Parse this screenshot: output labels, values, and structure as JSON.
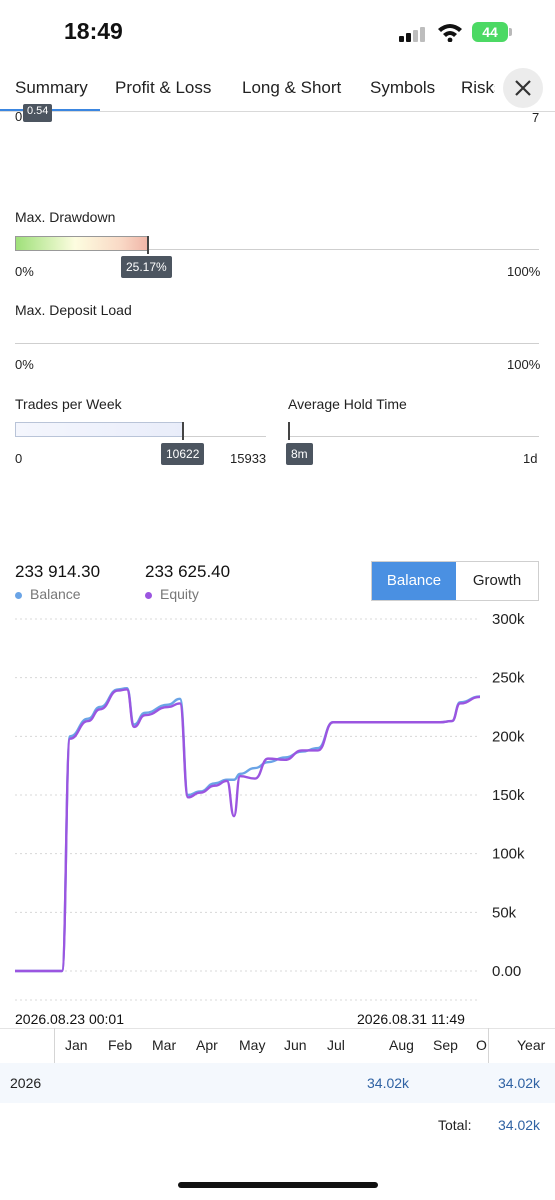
{
  "status_bar": {
    "time": "18:49",
    "battery": "44"
  },
  "tabs": [
    {
      "label": "Summary"
    },
    {
      "label": "Profit & Loss"
    },
    {
      "label": "Long & Short"
    },
    {
      "label": "Symbols"
    },
    {
      "label": "Risks"
    }
  ],
  "top_partial": {
    "left": "0.54",
    "right": "7"
  },
  "max_drawdown": {
    "label": "Max. Drawdown",
    "min": "0%",
    "max": "100%",
    "value": "25.17%",
    "fraction": 0.2517
  },
  "max_deposit_load": {
    "label": "Max. Deposit Load",
    "min": "0%",
    "max": "100%"
  },
  "trades_per_week": {
    "label": "Trades per Week",
    "min": "0",
    "max": "15933",
    "value": "10622",
    "fraction": 0.6667
  },
  "avg_hold_time": {
    "label": "Average Hold Time",
    "value": "8m",
    "max": "1d",
    "fraction": 0.0056
  },
  "summary_stats": {
    "balance_value": "233 914.30",
    "balance_label": "Balance",
    "equity_value": "233 625.40",
    "equity_label": "Equity"
  },
  "toggle": {
    "balance": "Balance",
    "growth": "Growth"
  },
  "colors": {
    "balance": "#6aa4e6",
    "equity": "#9b55e0",
    "accent": "#3b86e0",
    "button_active": "#4a90e2"
  },
  "chart_data": {
    "type": "line",
    "y_ticks": [
      "300k",
      "250k",
      "200k",
      "150k",
      "100k",
      "50k",
      "0.00"
    ],
    "ylim": [
      0,
      300000
    ],
    "x_start_label": "2026.08.23 00:01",
    "x_end_label": "2026.08.31 11:49",
    "series": [
      {
        "name": "Balance",
        "color": "#6aa4e6",
        "values": [
          0,
          0,
          200000,
          215000,
          225000,
          240000,
          241000,
          210000,
          220000,
          227000,
          232000,
          150000,
          153000,
          160000,
          163000,
          163000,
          168000,
          173000,
          178000,
          182000,
          187000,
          190000,
          212000,
          212000,
          212000,
          212000,
          213000,
          229000,
          234000
        ]
      },
      {
        "name": "Equity",
        "color": "#9b55e0",
        "values": [
          0,
          0,
          198000,
          213000,
          223000,
          239000,
          240000,
          208000,
          218000,
          225000,
          228000,
          148000,
          152000,
          158000,
          162000,
          132000,
          166000,
          164000,
          181000,
          180000,
          188000,
          188000,
          212000,
          212000,
          212000,
          212000,
          213000,
          228000,
          233600
        ]
      }
    ]
  },
  "monthly_table": {
    "months": [
      "Jan",
      "Feb",
      "Mar",
      "Apr",
      "May",
      "Jun",
      "Jul",
      "Aug",
      "Sep",
      "O"
    ],
    "year_header": "Year",
    "year": "2026",
    "aug_value": "34.02k",
    "year_value": "34.02k",
    "total_label": "Total:",
    "total_value": "34.02k"
  }
}
